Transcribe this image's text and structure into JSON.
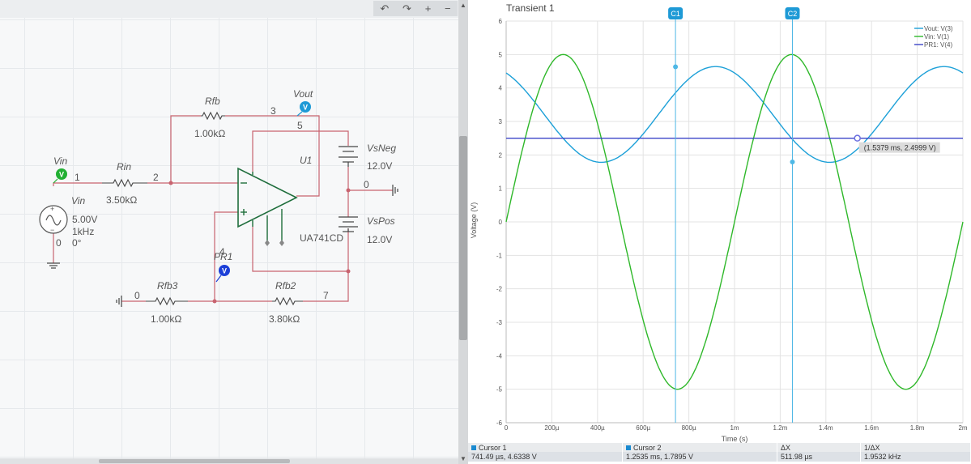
{
  "toolbar": {
    "undo": "↶",
    "redo": "↷",
    "zoom_in": "+",
    "zoom_out": "−"
  },
  "schematic": {
    "labels": {
      "vin_probe": "Vin",
      "rin_name": "Rin",
      "rin_value": "3.50kΩ",
      "rfb_name": "Rfb",
      "rfb_value": "1.00kΩ",
      "vout_probe": "Vout",
      "node3": "3",
      "node5": "5",
      "node1": "1",
      "node2": "2",
      "u1": "U1",
      "opamp_model": "UA741CD",
      "vsneg_name": "VsNeg",
      "vsneg_value": "12.0V",
      "node0_right": "0",
      "vspos_name": "VsPos",
      "vspos_value": "12.0V",
      "vin_source_name": "Vin",
      "vin_amplitude": "5.00V",
      "vin_freq": "1kHz",
      "vin_phase": "0°",
      "node0_left": "0",
      "node4": "4",
      "pr1_probe": "PR1",
      "rfb3_name": "Rfb3",
      "rfb3_value": "1.00kΩ",
      "node0_bottom": "0",
      "rfb2_name": "Rfb2",
      "rfb2_value": "3.80kΩ",
      "node7": "7",
      "probe_v": "V"
    },
    "colors": {
      "wire": "#c8636f",
      "opamp": "#1f6e3c",
      "probe_green": "#22b033",
      "probe_light_blue": "#1e9ad6",
      "probe_blue": "#1c3fd8"
    }
  },
  "plot": {
    "title": "Transient 1",
    "cursor1_label": "C1",
    "cursor2_label": "C2",
    "tooltip": "(1.5379 ms, 2.4999 V)",
    "ylabel": "Voltage (V)",
    "xlabel": "Time (s)"
  },
  "chart_data": {
    "type": "line",
    "title": "Transient 1",
    "xlabel": "Time (s)",
    "ylabel": "Voltage (V)",
    "xlim": [
      0,
      0.002
    ],
    "ylim": [
      -6,
      6
    ],
    "x_ticks": [
      "0",
      "200µ",
      "400µ",
      "600µ",
      "800µ",
      "1m",
      "1.2m",
      "1.4m",
      "1.6m",
      "1.8m",
      "2m"
    ],
    "y_ticks": [
      "6",
      "5",
      "4",
      "3",
      "2",
      "1",
      "0",
      "-1",
      "-2",
      "-3",
      "-4",
      "-5",
      "-6"
    ],
    "grid": true,
    "legend_position": "top-right",
    "series": [
      {
        "name": "Vout: V(3)",
        "color": "#1ca0d8",
        "kind": "sine",
        "offset": 3.21,
        "amplitude": 1.43,
        "frequency_hz": 1000,
        "phase_deg": 120
      },
      {
        "name": "Vin: V(1)",
        "color": "#2fb82a",
        "kind": "sine",
        "offset": 0,
        "amplitude": 5,
        "frequency_hz": 1000,
        "phase_deg": 0
      },
      {
        "name": "PR1: V(4)",
        "color": "#3b44c8",
        "kind": "constant",
        "value": 2.5
      }
    ],
    "cursors": [
      {
        "label": "C1",
        "x": 0.00074149,
        "y": 4.6338
      },
      {
        "label": "C2",
        "x": 0.0012535,
        "y": 1.7895
      }
    ],
    "marker": {
      "x": 0.0015379,
      "y": 2.4999
    }
  },
  "cursor_table": {
    "headers": [
      "Cursor 1",
      "Cursor 2",
      "ΔX",
      "1/ΔX"
    ],
    "values": [
      "741.49 µs, 4.6338 V",
      "1.2535 ms, 1.7895 V",
      "511.98 µs",
      "1.9532 kHz"
    ]
  }
}
